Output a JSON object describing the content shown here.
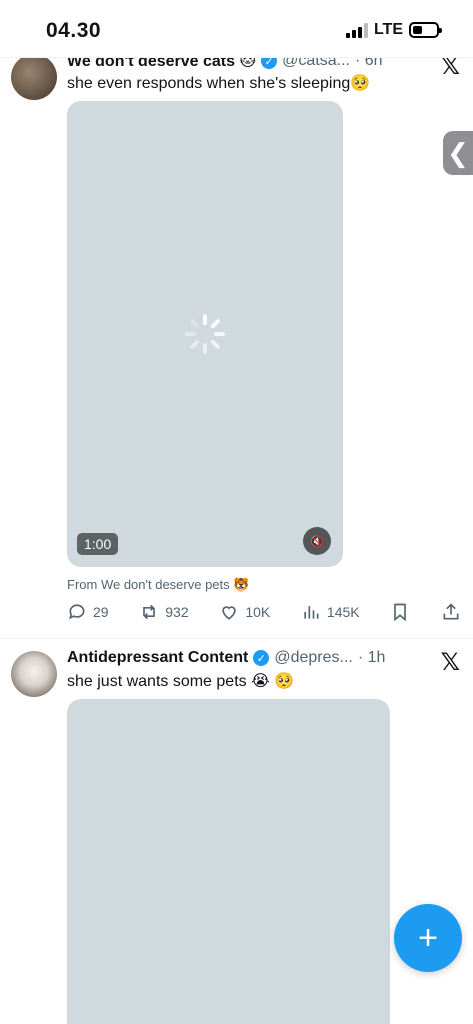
{
  "status_bar": {
    "time": "04.30",
    "network": "LTE"
  },
  "tweets": [
    {
      "name": "We don't deserve cats 🐱",
      "handle": "@catsa...",
      "time": "· 6h",
      "text": "she even responds when she's sleeping🥺",
      "media": {
        "duration": "1:00",
        "state": "loading"
      },
      "from": "From We don't deserve pets 🐯",
      "stats": {
        "replies": "29",
        "reposts": "932",
        "likes": "10K",
        "views": "145K"
      }
    },
    {
      "name": "Antidepressant Content",
      "handle": "@depres...",
      "time": "· 1h",
      "text": "she just wants some pets 😭 🥺"
    }
  ],
  "icons": {
    "verified": "verified-badge-icon",
    "x_logo": "x-logo-icon",
    "reply": "reply-icon",
    "repost": "repost-icon",
    "like": "heart-icon",
    "views": "views-icon",
    "bookmark": "bookmark-icon",
    "share": "share-icon",
    "mute": "muted-speaker-icon",
    "compose": "plus-icon"
  },
  "colors": {
    "accent": "#1d9bf0",
    "media_placeholder": "#cfd9de",
    "secondary_text": "#536471"
  }
}
